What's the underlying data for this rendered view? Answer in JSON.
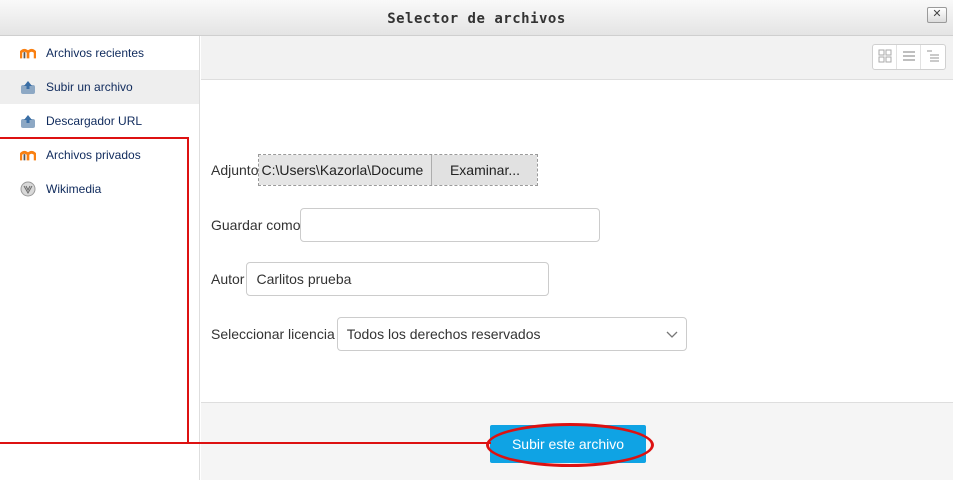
{
  "dialog": {
    "title": "Selector de archivos",
    "close_symbol": "✕"
  },
  "sidebar": {
    "items": [
      {
        "label": "Archivos recientes",
        "icon": "moodle-logo-icon"
      },
      {
        "label": "Subir un archivo",
        "icon": "upload-icon",
        "active": true
      },
      {
        "label": "Descargador URL",
        "icon": "url-download-icon"
      },
      {
        "label": "Archivos privados",
        "icon": "moodle-logo-icon"
      },
      {
        "label": "Wikimedia",
        "icon": "wikimedia-icon"
      }
    ]
  },
  "toolbar": {
    "views": [
      "grid-view-icon",
      "list-view-icon",
      "tree-view-icon"
    ]
  },
  "form": {
    "attachment_label": "Adjunto",
    "attachment_path": "C:\\Users\\Kazorla\\Docume",
    "browse_label": "Examinar...",
    "save_as_label": "Guardar como",
    "save_as_value": "",
    "author_label": "Autor",
    "author_value": "Carlitos prueba",
    "license_label": "Seleccionar licencia",
    "license_value": "Todos los derechos reservados"
  },
  "footer": {
    "submit_label": "Subir este archivo"
  },
  "colors": {
    "submit_bg": "#0fa3e4",
    "annotation": "#dd1111",
    "sidebar_link": "#0f2a5c",
    "moodle_orange": "#f98012"
  }
}
